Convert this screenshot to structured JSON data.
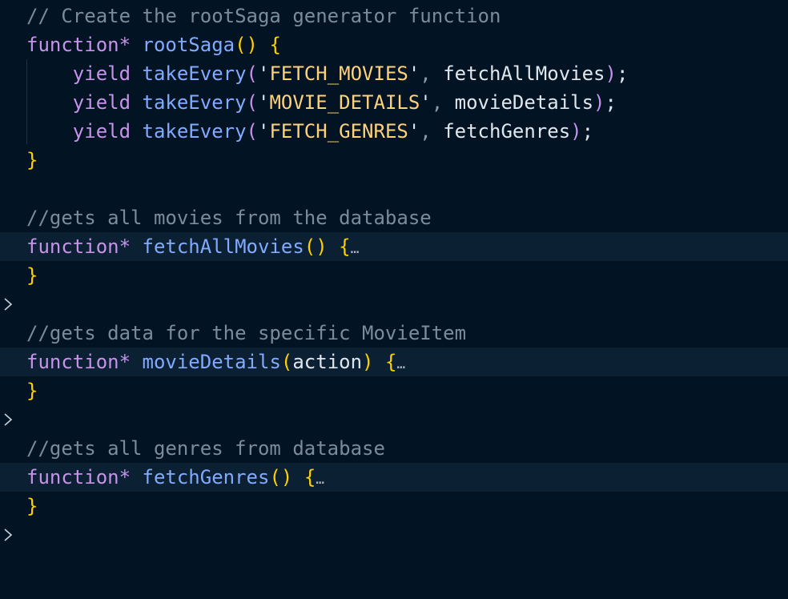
{
  "code": {
    "comment_root": "// Create the rootSaga generator function",
    "keyword_function": "function*",
    "keyword_yield": "yield",
    "root_name": "rootSaga",
    "take_every": "takeEvery",
    "paren_open": "(",
    "paren_close": ")",
    "parens_empty": "()",
    "brace_open": "{",
    "brace_close": "}",
    "comma": ",",
    "semicolon": ";",
    "quote": "'",
    "ellipsis": "…",
    "yields": [
      {
        "action": "FETCH_MOVIES",
        "handler": "fetchAllMovies"
      },
      {
        "action": "MOVIE_DETAILS",
        "handler": "movieDetails"
      },
      {
        "action": "FETCH_GENRES",
        "handler": "fetchGenres"
      }
    ],
    "comment_movies": "//gets all movies from the database",
    "fetch_all_movies": "fetchAllMovies",
    "comment_details": "//gets data for the specific MovieItem",
    "movie_details": "movieDetails",
    "movie_details_param": "action",
    "comment_genres": "//gets all genres from database",
    "fetch_genres": "fetchGenres"
  },
  "icons": {
    "fold": "chevron-right-icon"
  },
  "colors": {
    "background": "#021424",
    "folded_line": "#0b2033",
    "comment": "#7d8b99",
    "keyword": "#c792ea",
    "function": "#82aaff",
    "bracket": "#ffd000",
    "string": "#ffd27a",
    "text": "#e0e6ee"
  }
}
